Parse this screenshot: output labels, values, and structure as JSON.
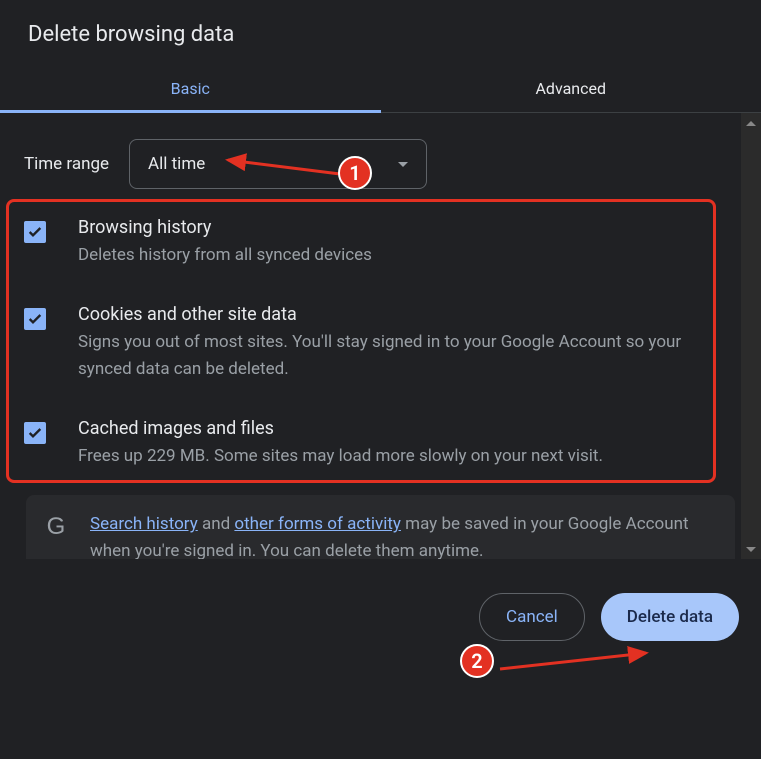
{
  "title": "Delete browsing data",
  "tabs": {
    "basic": "Basic",
    "advanced": "Advanced"
  },
  "time": {
    "label": "Time range",
    "value": "All time"
  },
  "items": [
    {
      "head": "Browsing history",
      "sub": "Deletes history from all synced devices"
    },
    {
      "head": "Cookies and other site data",
      "sub": "Signs you out of most sites. You'll stay signed in to your Google Account so your synced data can be deleted."
    },
    {
      "head": "Cached images and files",
      "sub": "Frees up 229 MB. Some sites may load more slowly on your next visit."
    }
  ],
  "info": {
    "link1": "Search history",
    "mid1": " and ",
    "link2": "other forms of activity",
    "rest": " may be saved in your Google Account when you're signed in. You can delete them anytime."
  },
  "footer": {
    "cancel": "Cancel",
    "delete": "Delete data"
  },
  "annotations": {
    "badge1": "1",
    "badge2": "2"
  },
  "colors": {
    "accent": "#8ab4f8",
    "annotation": "#e33122"
  }
}
